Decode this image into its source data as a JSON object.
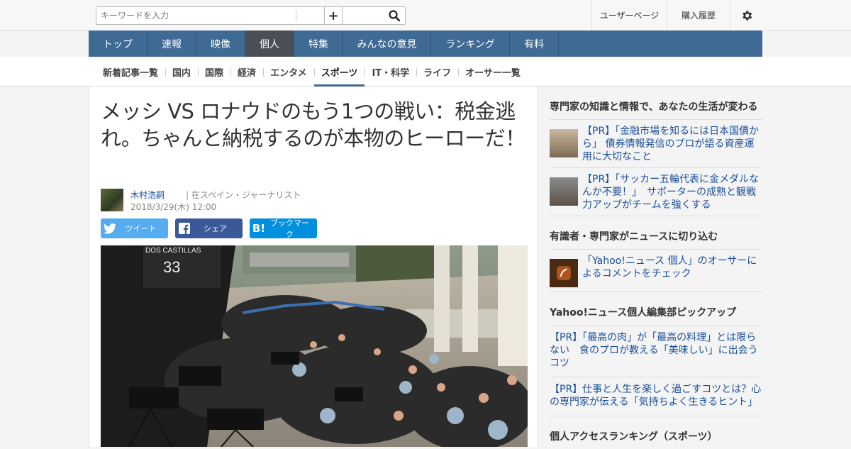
{
  "header": {
    "search_placeholder": "キーワードを入力",
    "add_label": "+",
    "links": [
      "ユーザーページ",
      "購入履歴"
    ]
  },
  "nav": {
    "items": [
      "トップ",
      "速報",
      "映像",
      "個人",
      "特集",
      "みんなの意見",
      "ランキング",
      "有料"
    ],
    "active": "個人"
  },
  "subnav": {
    "items": [
      "新着記事一覧",
      "国内",
      "国際",
      "経済",
      "エンタメ",
      "スポーツ",
      "IT・科学",
      "ライフ",
      "オーサー一覧"
    ],
    "active": "スポーツ"
  },
  "article": {
    "title": "メッシ VS ロナウドのもう1つの戦い：税金逃れ。ちゃんと納税するのが本物のヒーローだ！",
    "author_name": "木村浩嗣",
    "author_desc": "| 在スペイン・ジャーナリスト",
    "date": "2018/3/29(木) 12:00",
    "share": {
      "twitter": "ツイート",
      "facebook": "シェア",
      "hatena": "ブックマーク"
    },
    "photo_sign": "DOS CASTILLAS",
    "photo_number": "33"
  },
  "sidebar": {
    "section1": {
      "heading": "専門家の知識と情報で、あなたの生活が変わる",
      "items": [
        "【PR】「金融市場を知るには日本国債から」 債券情報発信のプロが語る資産運用に大切なこと",
        "【PR】「サッカー五輪代表に金メダルなんか不要！」　サポーターの成熟と観戦力アップがチームを強くする"
      ]
    },
    "section2": {
      "heading": "有識者・専門家がニュースに切り込む",
      "items": [
        "「Yahoo!ニュース 個人」のオーサーによるコメントをチェック"
      ]
    },
    "section3": {
      "heading": "Yahoo!ニュース個人編集部ピックアップ",
      "items": [
        "【PR】「最高の肉」が「最高の料理」とは限らない　食のプロが教える「美味しい」に出会うコツ",
        "【PR】仕事と人生を楽しく過ごすコツとは？心の専門家が伝える「気持ちよく生きるヒント」"
      ]
    },
    "section4": {
      "heading": "個人アクセスランキング（スポーツ）"
    }
  },
  "colors": {
    "nav_bg": "#3e6a94",
    "nav_active": "#4a4f57",
    "link": "#1a4f9c",
    "twitter": "#55acee",
    "facebook": "#3b5998",
    "hatena": "#008fde"
  }
}
